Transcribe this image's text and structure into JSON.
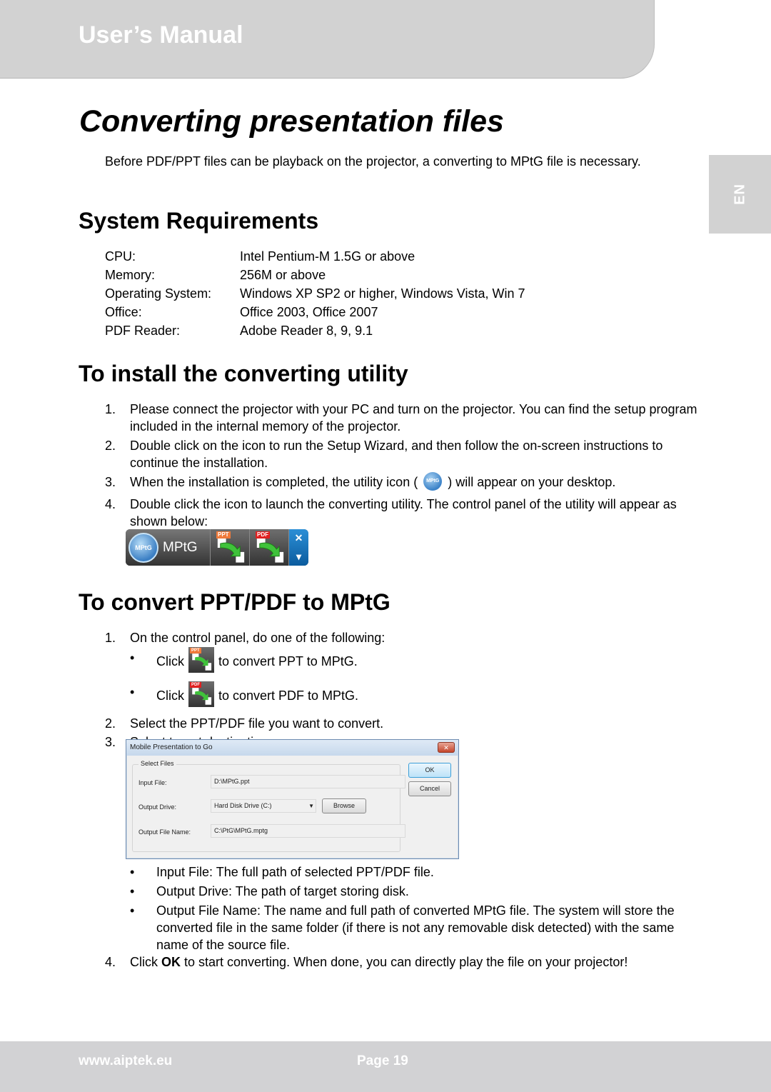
{
  "header": {
    "title": "User’s Manual"
  },
  "language_tab": "EN",
  "page_title": "Converting presentation files",
  "intro": "Before PDF/PPT files can be playback on the projector, a converting to MPtG file is necessary.",
  "system_requirements": {
    "heading": "System Requirements",
    "rows": [
      {
        "label": "CPU:",
        "value": "Intel Pentium-M 1.5G or above"
      },
      {
        "label": "Memory:",
        "value": "256M or above"
      },
      {
        "label": "Operating System:",
        "value": "Windows XP SP2 or higher, Windows Vista, Win 7"
      },
      {
        "label": "Office:",
        "value": "Office 2003, Office 2007"
      },
      {
        "label": "PDF Reader:",
        "value": "Adobe Reader 8, 9, 9.1"
      }
    ]
  },
  "install": {
    "heading": "To install the converting utility",
    "steps": [
      {
        "num": "1.",
        "text": "Please connect the projector with your PC and turn on the projector. You can find the setup program included in the internal memory of the projector."
      },
      {
        "num": "2.",
        "text": "Double click on the icon to run the Setup Wizard, and then follow the on-screen instructions to continue the installation."
      },
      {
        "num": "3.",
        "text_before": "When the installation is completed, the utility icon (",
        "text_after": ") will appear on your desktop.",
        "icon_label": "MPtG"
      },
      {
        "num": "4.",
        "text": "Double click the icon to launch the converting utility. The control panel of the utility will appear as shown below:"
      }
    ],
    "control_panel": {
      "logo_text": "MPtG",
      "label": "MPtG",
      "ppt_tag": "PPT",
      "pdf_tag": "PDF",
      "close_glyph": "✕",
      "menu_glyph": "▾"
    }
  },
  "convert": {
    "heading": "To convert PPT/PDF to MPtG",
    "step1": {
      "num": "1.",
      "text": "On the control panel, do one of the following:"
    },
    "sub_bullets": [
      {
        "click": "Click",
        "tag": "PPT",
        "text": "to convert PPT to MPtG."
      },
      {
        "click": "Click",
        "tag": "PDF",
        "text": "to convert PDF to MPtG."
      }
    ],
    "step2": {
      "num": "2.",
      "text": "Select the PPT/PDF file you want to convert."
    },
    "step3": {
      "num": "3.",
      "text": "Select target destination."
    },
    "dialog": {
      "title": "Mobile Presentation to Go",
      "close_glyph": "✕",
      "group_label": "Select Files",
      "input_file_label": "Input File:",
      "input_file_value": "D:\\MPtG.ppt",
      "output_drive_label": "Output Drive:",
      "output_drive_value": "Hard Disk Drive (C:)",
      "browse_label": "Browse",
      "output_name_label": "Output File Name:",
      "output_name_value": "C:\\PtG\\MPtG.mptg",
      "ok_label": "OK",
      "cancel_label": "Cancel"
    },
    "field_notes": [
      "Input File: The full path of selected PPT/PDF file.",
      "Output Drive: The path of target storing disk.",
      "Output File Name: The name and full path of converted MPtG file. The system will store the converted file in the same folder (if there is not any removable disk detected) with the same name of the source file."
    ],
    "step4": {
      "num": "4.",
      "before": "Click ",
      "bold": "OK",
      "after": " to start converting. When done, you can directly play the file on your projector!"
    }
  },
  "footer": {
    "url": "www.aiptek.eu",
    "page": "Page 19"
  }
}
